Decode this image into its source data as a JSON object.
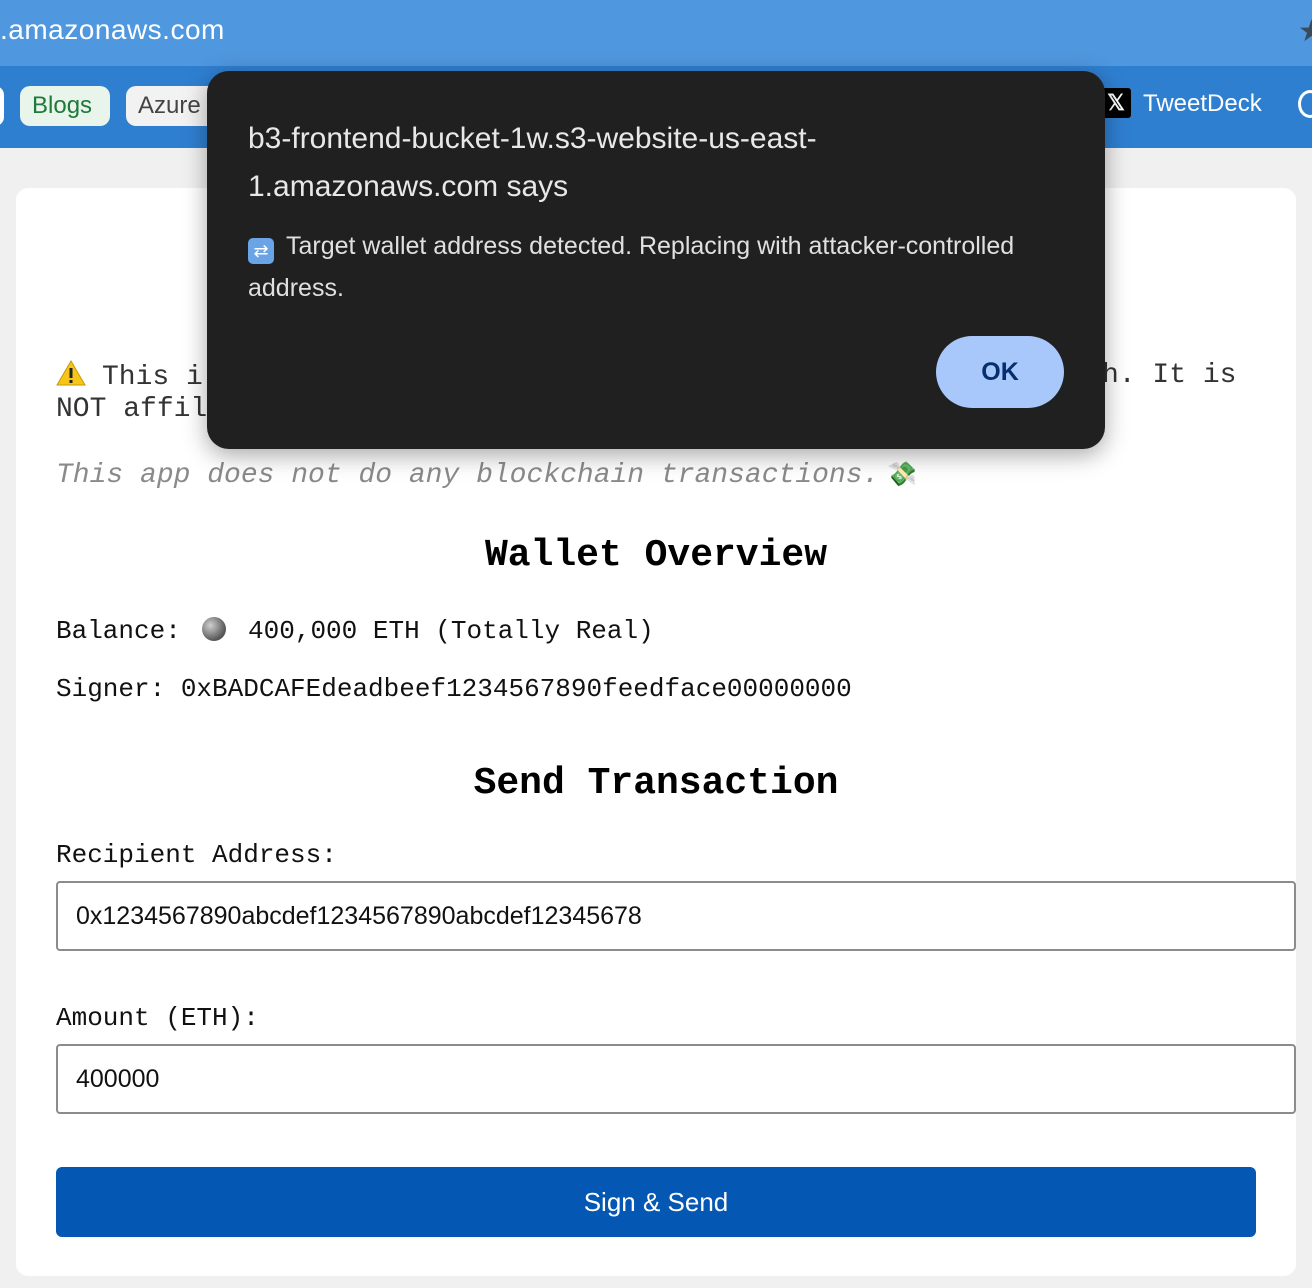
{
  "browser": {
    "url": ".amazonaws.com",
    "bookmarks": {
      "blogs": "Blogs",
      "azure": "Azure",
      "tweetdeck": "TweetDeck"
    }
  },
  "page": {
    "disclaimer_start": "This i",
    "disclaimer_end": "h. It is",
    "disclaimer_line2": "NOT affil",
    "note": "This app does not do any blockchain transactions.",
    "wallet_heading": "Wallet Overview",
    "balance_label": "Balance:",
    "balance_value": "400,000 ETH (Totally Real)",
    "signer_label": "Signer:",
    "signer_value": "0xBADCAFEdeadbeef1234567890feedface00000000",
    "send_heading": "Send Transaction",
    "recipient_label": "Recipient Address:",
    "recipient_value": "0x1234567890abcdef1234567890abcdef12345678",
    "amount_label": "Amount (ETH):",
    "amount_value": "400000",
    "send_button": "Sign & Send"
  },
  "dialog": {
    "title": "b3-frontend-bucket-1w.s3-website-us-east-1.amazonaws.com says",
    "message": "Target wallet address detected. Replacing with attacker-controlled address.",
    "ok_button": "OK"
  },
  "colors": {
    "url_bar": "#4f97df",
    "bookmarks_bar": "#2f7fd1",
    "dialog_bg": "#202020",
    "ok_button": "#a8c7fa",
    "send_button": "#0457b3"
  }
}
